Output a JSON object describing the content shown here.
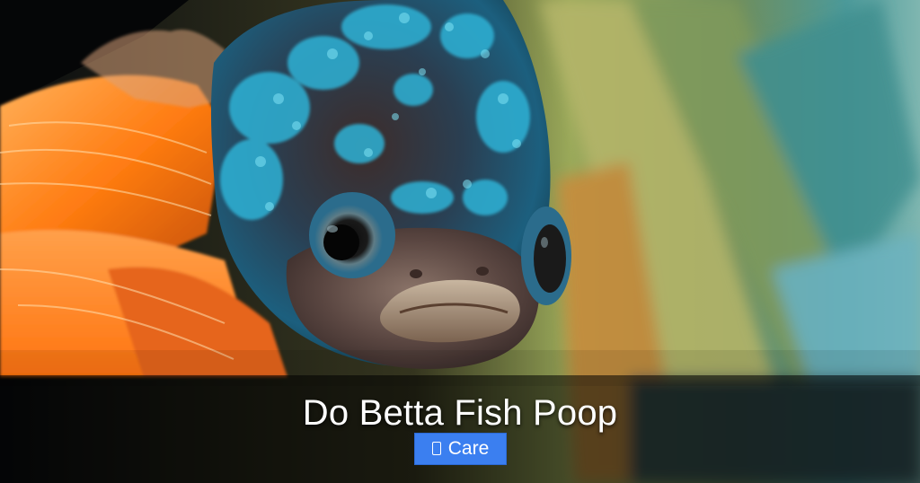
{
  "hero": {
    "image_subject": "betta-fish",
    "title": "Do Betta Fish Poop",
    "category": {
      "label": "Care",
      "icon": "folder-icon",
      "color": "#3b7ff0"
    }
  },
  "colors": {
    "fish_body": "#2a5d7a",
    "fish_scales": "#2fb2d6",
    "fin_orange": "#ff8a1e",
    "background_green": "#8fae6a",
    "caption_band": "#000000"
  }
}
